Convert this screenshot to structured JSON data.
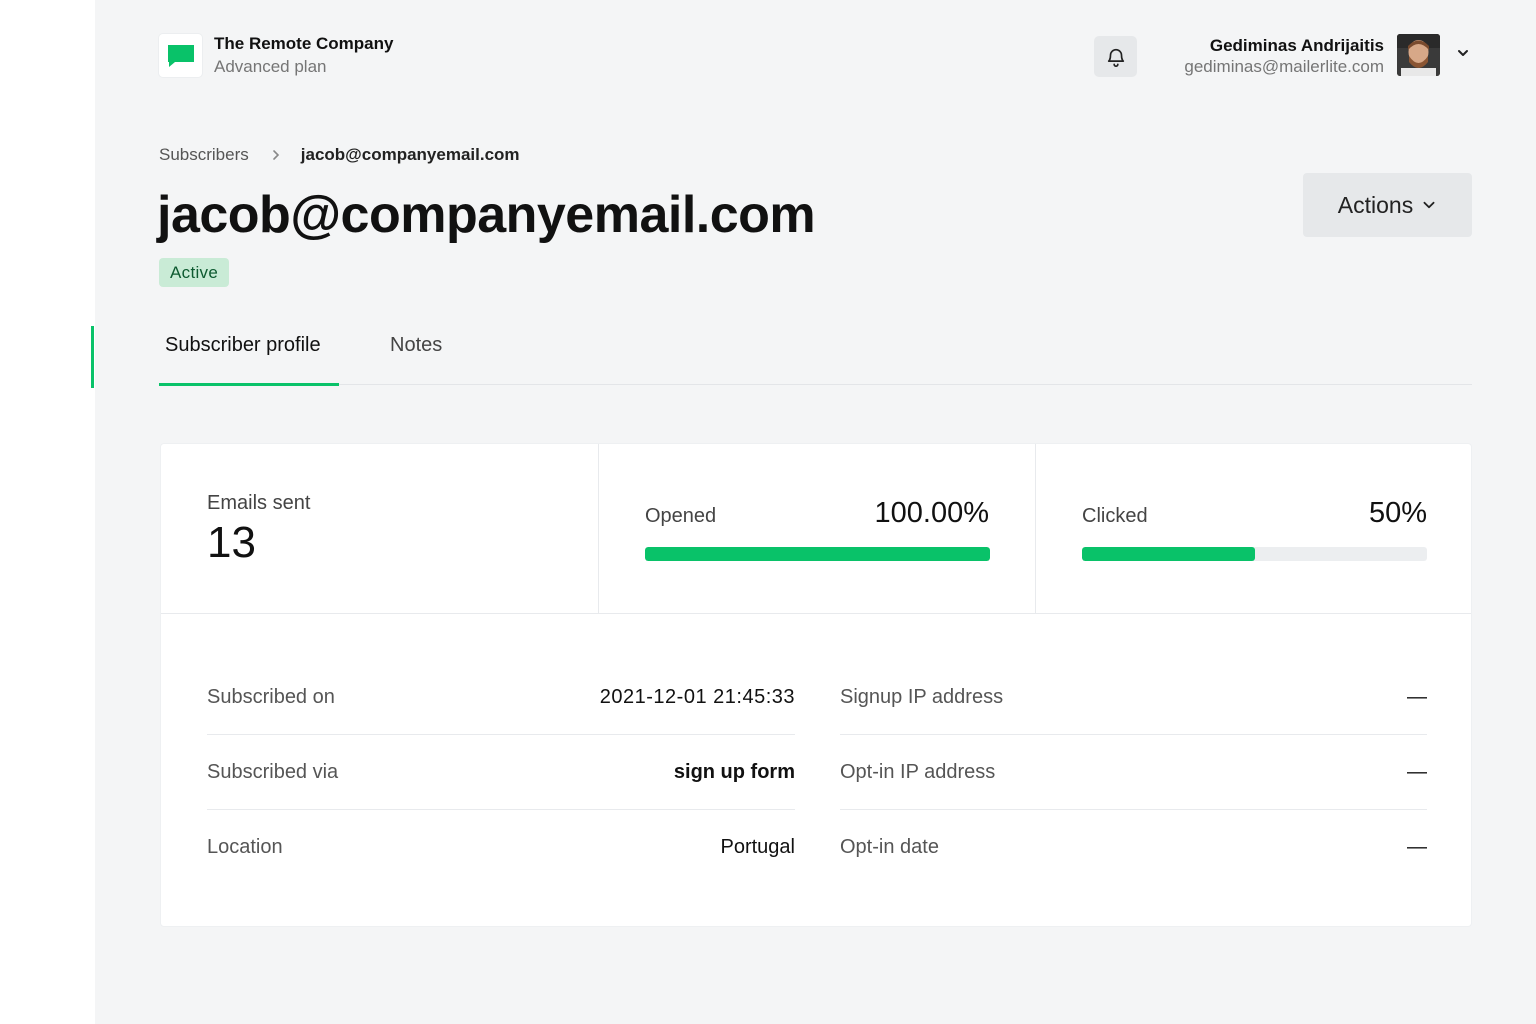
{
  "org": {
    "name": "The Remote Company",
    "plan": "Advanced plan"
  },
  "user": {
    "name": "Gediminas Andrijaitis",
    "email": "gediminas@mailerlite.com"
  },
  "breadcrumb": {
    "parent": "Subscribers",
    "current": "jacob@companyemail.com"
  },
  "page": {
    "title": "jacob@companyemail.com",
    "status": "Active",
    "actions_label": "Actions"
  },
  "tabs": [
    {
      "label": "Subscriber profile"
    },
    {
      "label": "Notes"
    }
  ],
  "stats": {
    "emails_sent": {
      "label": "Emails sent",
      "value": "13"
    },
    "opened": {
      "label": "Opened",
      "value": "100.00%",
      "fraction": 1.0
    },
    "clicked": {
      "label": "Clicked",
      "value": "50%",
      "fraction": 0.5
    }
  },
  "details": {
    "left": [
      {
        "label": "Subscribed on",
        "value": "2021-12-01 21:45:33"
      },
      {
        "label": "Subscribed via",
        "value": "sign up form"
      },
      {
        "label": "Location",
        "value": "Portugal"
      }
    ],
    "right": [
      {
        "label": "Signup IP address",
        "value": "—"
      },
      {
        "label": "Opt-in IP address",
        "value": "—"
      },
      {
        "label": "Opt-in date",
        "value": "—"
      }
    ]
  },
  "colors": {
    "accent": "#09c269",
    "badge_bg": "#c9ebd6",
    "badge_text": "#0d5a30",
    "page_bg": "#f4f5f6"
  }
}
